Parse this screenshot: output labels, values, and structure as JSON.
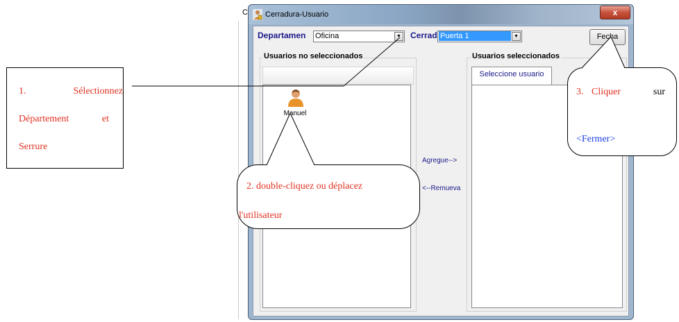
{
  "background_app": {
    "title_fragment": "Ce"
  },
  "window": {
    "title": "Cerradura-Usuario",
    "close_glyph": "x"
  },
  "top_bar": {
    "department_label": "Departamen",
    "department_value": "Oficina",
    "lock_label": "Cerrad",
    "lock_value": "Puerta 1",
    "close_button_label": "Fecha"
  },
  "left_group": {
    "title": "Usuarios no seleccionados",
    "users": [
      {
        "name": "Manuel",
        "icon": "user-icon"
      }
    ]
  },
  "right_group": {
    "title": "Usuarios seleccionados",
    "tab_label": "Seleccione usuario"
  },
  "middle": {
    "add_label": "Agregue-->",
    "remove_label": "<--Remueva"
  },
  "callouts": {
    "step1": {
      "line1_num": "1.",
      "line1_word": "Sélectionnez",
      "line2_a": "Département",
      "line2_b": "et",
      "line3": "Serrure"
    },
    "step2": {
      "line1": "2. double-cliquez ou déplacez",
      "line2": "l'utilisateur"
    },
    "step3": {
      "line1_num": "3.",
      "line1_word": "Cliquer",
      "line1_sur": "sur",
      "line2": "<Fermer>"
    }
  },
  "colors": {
    "callout_red": "#e03020",
    "callout_blue": "#1a3fe0",
    "label_blue": "#1a1a8a",
    "selection_blue": "#3399ff"
  }
}
